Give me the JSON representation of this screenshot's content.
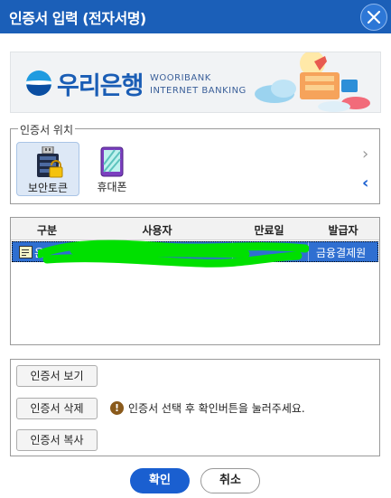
{
  "window": {
    "title": "인증서 입력 (전자서명)"
  },
  "banner": {
    "brand": "우리은행",
    "line1": "WOORIBANK",
    "line2": "INTERNET BANKING"
  },
  "location": {
    "legend": "인증서 위치",
    "devices": [
      {
        "label": "보안토큰",
        "icon": "usb-token-lock-icon",
        "selected": true
      },
      {
        "label": "휴대폰",
        "icon": "mobile-phone-icon",
        "selected": false
      }
    ],
    "arrow_right": "›",
    "arrow_left": "‹"
  },
  "certificates": {
    "columns": [
      "구분",
      "사용자",
      "만료일",
      "발급자"
    ],
    "rows": [
      {
        "type": "은",
        "user": "",
        "expiry": "",
        "issuer": "금융결제원"
      }
    ]
  },
  "actions": {
    "view": "인증서 보기",
    "delete": "인증서 삭제",
    "copy": "인증서 복사",
    "notice": "인증서 선택 후 확인버튼을 눌러주세요.",
    "notice_icon": "!"
  },
  "footer": {
    "confirm": "확인",
    "cancel": "취소"
  },
  "colors": {
    "titlebar": "#1b5fb8",
    "selected_row": "#2f6fd1",
    "confirm": "#1a5fd0",
    "highlight_scribble": "#00e000"
  }
}
